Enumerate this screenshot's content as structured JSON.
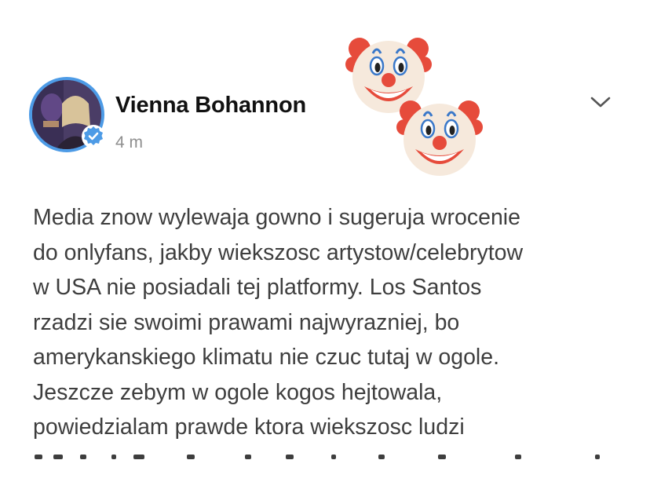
{
  "post": {
    "author": "Vienna Bohannon",
    "timestamp": "4 m",
    "body": "Media znow wylewaja gowno i sugeruja wrocenie\ndo onlyfans, jakby wiekszosc artystow/celebrytow\nw USA nie posiadali tej platformy. Los Santos\nrzadzi sie swoimi prawami najwyrazniej, bo\namerykanskiego klimatu nie czuc tutaj w ogole.\nJeszcze zebym w ogole kogos hejtowala,\npowiedzialam prawde ktora wiekszosc ludzi",
    "verified": true,
    "menu_icon": "chevron-down-icon",
    "reaction_emoji": [
      "clown-face-icon",
      "clown-face-icon"
    ]
  },
  "colors": {
    "verified_blue": "#4d9be6",
    "text": "#3e3e3e",
    "muted": "#8e8e8e"
  }
}
